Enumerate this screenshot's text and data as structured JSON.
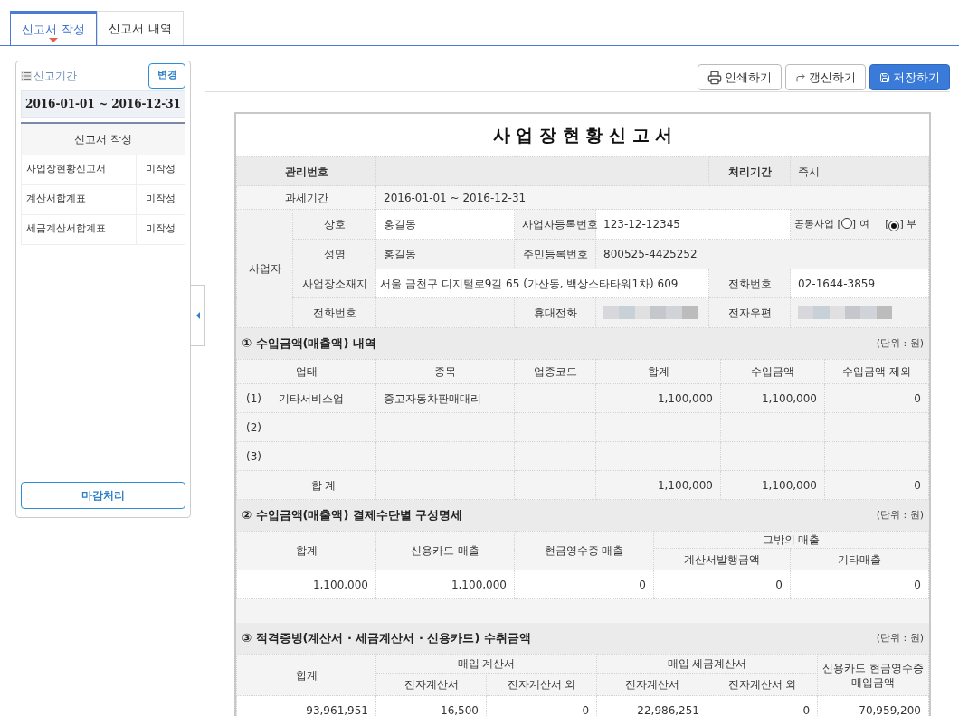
{
  "tabs": [
    {
      "label": "신고서 작성",
      "selected": true
    },
    {
      "label": "신고서 내역",
      "selected": false
    }
  ],
  "sidebar": {
    "period_label": "신고기간",
    "change_button": "변경",
    "period": "2016-01-01 ~ 2016-12-31",
    "section_title": "신고서 작성",
    "items": [
      {
        "name": "사업장현황신고서",
        "status": "미작성"
      },
      {
        "name": "계산서합계표",
        "status": "미작성"
      },
      {
        "name": "세금계산서합계표",
        "status": "미작성"
      }
    ],
    "close_button": "마감처리"
  },
  "toolbar": {
    "buttons": [
      {
        "label": "인쇄하기",
        "kind": "print"
      },
      {
        "label": "갱신하기",
        "kind": "refresh"
      },
      {
        "label": "저장하기",
        "kind": "save"
      }
    ]
  },
  "form": {
    "title": "사 업 장 현 황 신 고 서",
    "header": {
      "mgmt_label": "관리번호",
      "period_label": "처리기간",
      "period_value": "즉시"
    },
    "tax_period": {
      "label": "과세기간",
      "value": "2016-01-01 ~ 2016-12-31"
    },
    "business": {
      "group_label": "사업자",
      "trade_name_label": "상호",
      "trade_name": "홍길동",
      "reg_no_label": "사업자등록번호",
      "reg_no": "123-12-12345",
      "joint": {
        "label": "공동사업",
        "bracket_open": "[",
        "bracket_close": "]",
        "options": [
          {
            "label": "여",
            "selected": false
          },
          {
            "label": "부",
            "selected": true
          }
        ]
      },
      "name_label": "성명",
      "name": "홍길동",
      "rrn_label": "주민등록번호",
      "rrn": "800525-4425252",
      "address_label": "사업장소재지",
      "address": "서울 금천구 디지털로9길 65 (가산동, 백상스타타워1차) 609",
      "phone_label": "전화번호",
      "phone": "02-1644-3859",
      "tel_label": "전화번호",
      "mobile_label": "휴대전화",
      "email_label": "전자우편"
    },
    "section1": {
      "title": "① 수입금액(매출액) 내역",
      "unit": "(단위 : 원)",
      "columns": [
        "업태",
        "종목",
        "업종코드",
        "합계",
        "수입금액",
        "수입금액 제외"
      ],
      "rows": [
        {
          "index": "(1)",
          "business_type": "기타서비스업",
          "item": "중고자동차판매대리",
          "total": "1,100,000",
          "income": "1,100,000",
          "excluded": "0"
        },
        {
          "index": "(2)"
        },
        {
          "index": "(3)"
        }
      ],
      "total_row": {
        "label": "합 계",
        "total": "1,100,000",
        "income": "1,100,000",
        "excluded": "0"
      }
    },
    "section2": {
      "title": "② 수입금액(매출액) 결제수단별 구성명세",
      "unit": "(단위 : 원)",
      "headers": {
        "total": "합계",
        "card": "신용카드 매출",
        "cash": "현금영수증 매출",
        "other": "그밖의 매출",
        "invoice": "계산서발행금액",
        "etc": "기타매출"
      },
      "values": [
        "1,100,000",
        "1,100,000",
        "0",
        "0",
        "0"
      ]
    },
    "section3": {
      "title": "③ 적격증빙(계산서 · 세금계산서 · 신용카드) 수취금액",
      "unit": "(단위 : 원)",
      "headers": {
        "total": "합계",
        "bill": "매입 계산서",
        "tax_invoice": "매입 세금계산서",
        "bill_e_doc": "전자계산서",
        "bill_non_e_doc": "전자계산서 외",
        "tax_e_doc": "전자계산서",
        "tax_non_e_doc": "전자계산서 외",
        "card_cash": "신용카드 현금영수증 매입금액"
      },
      "values": [
        "93,961,951",
        "16,500",
        "0",
        "22,986,251",
        "0",
        "70,959,200"
      ]
    }
  }
}
